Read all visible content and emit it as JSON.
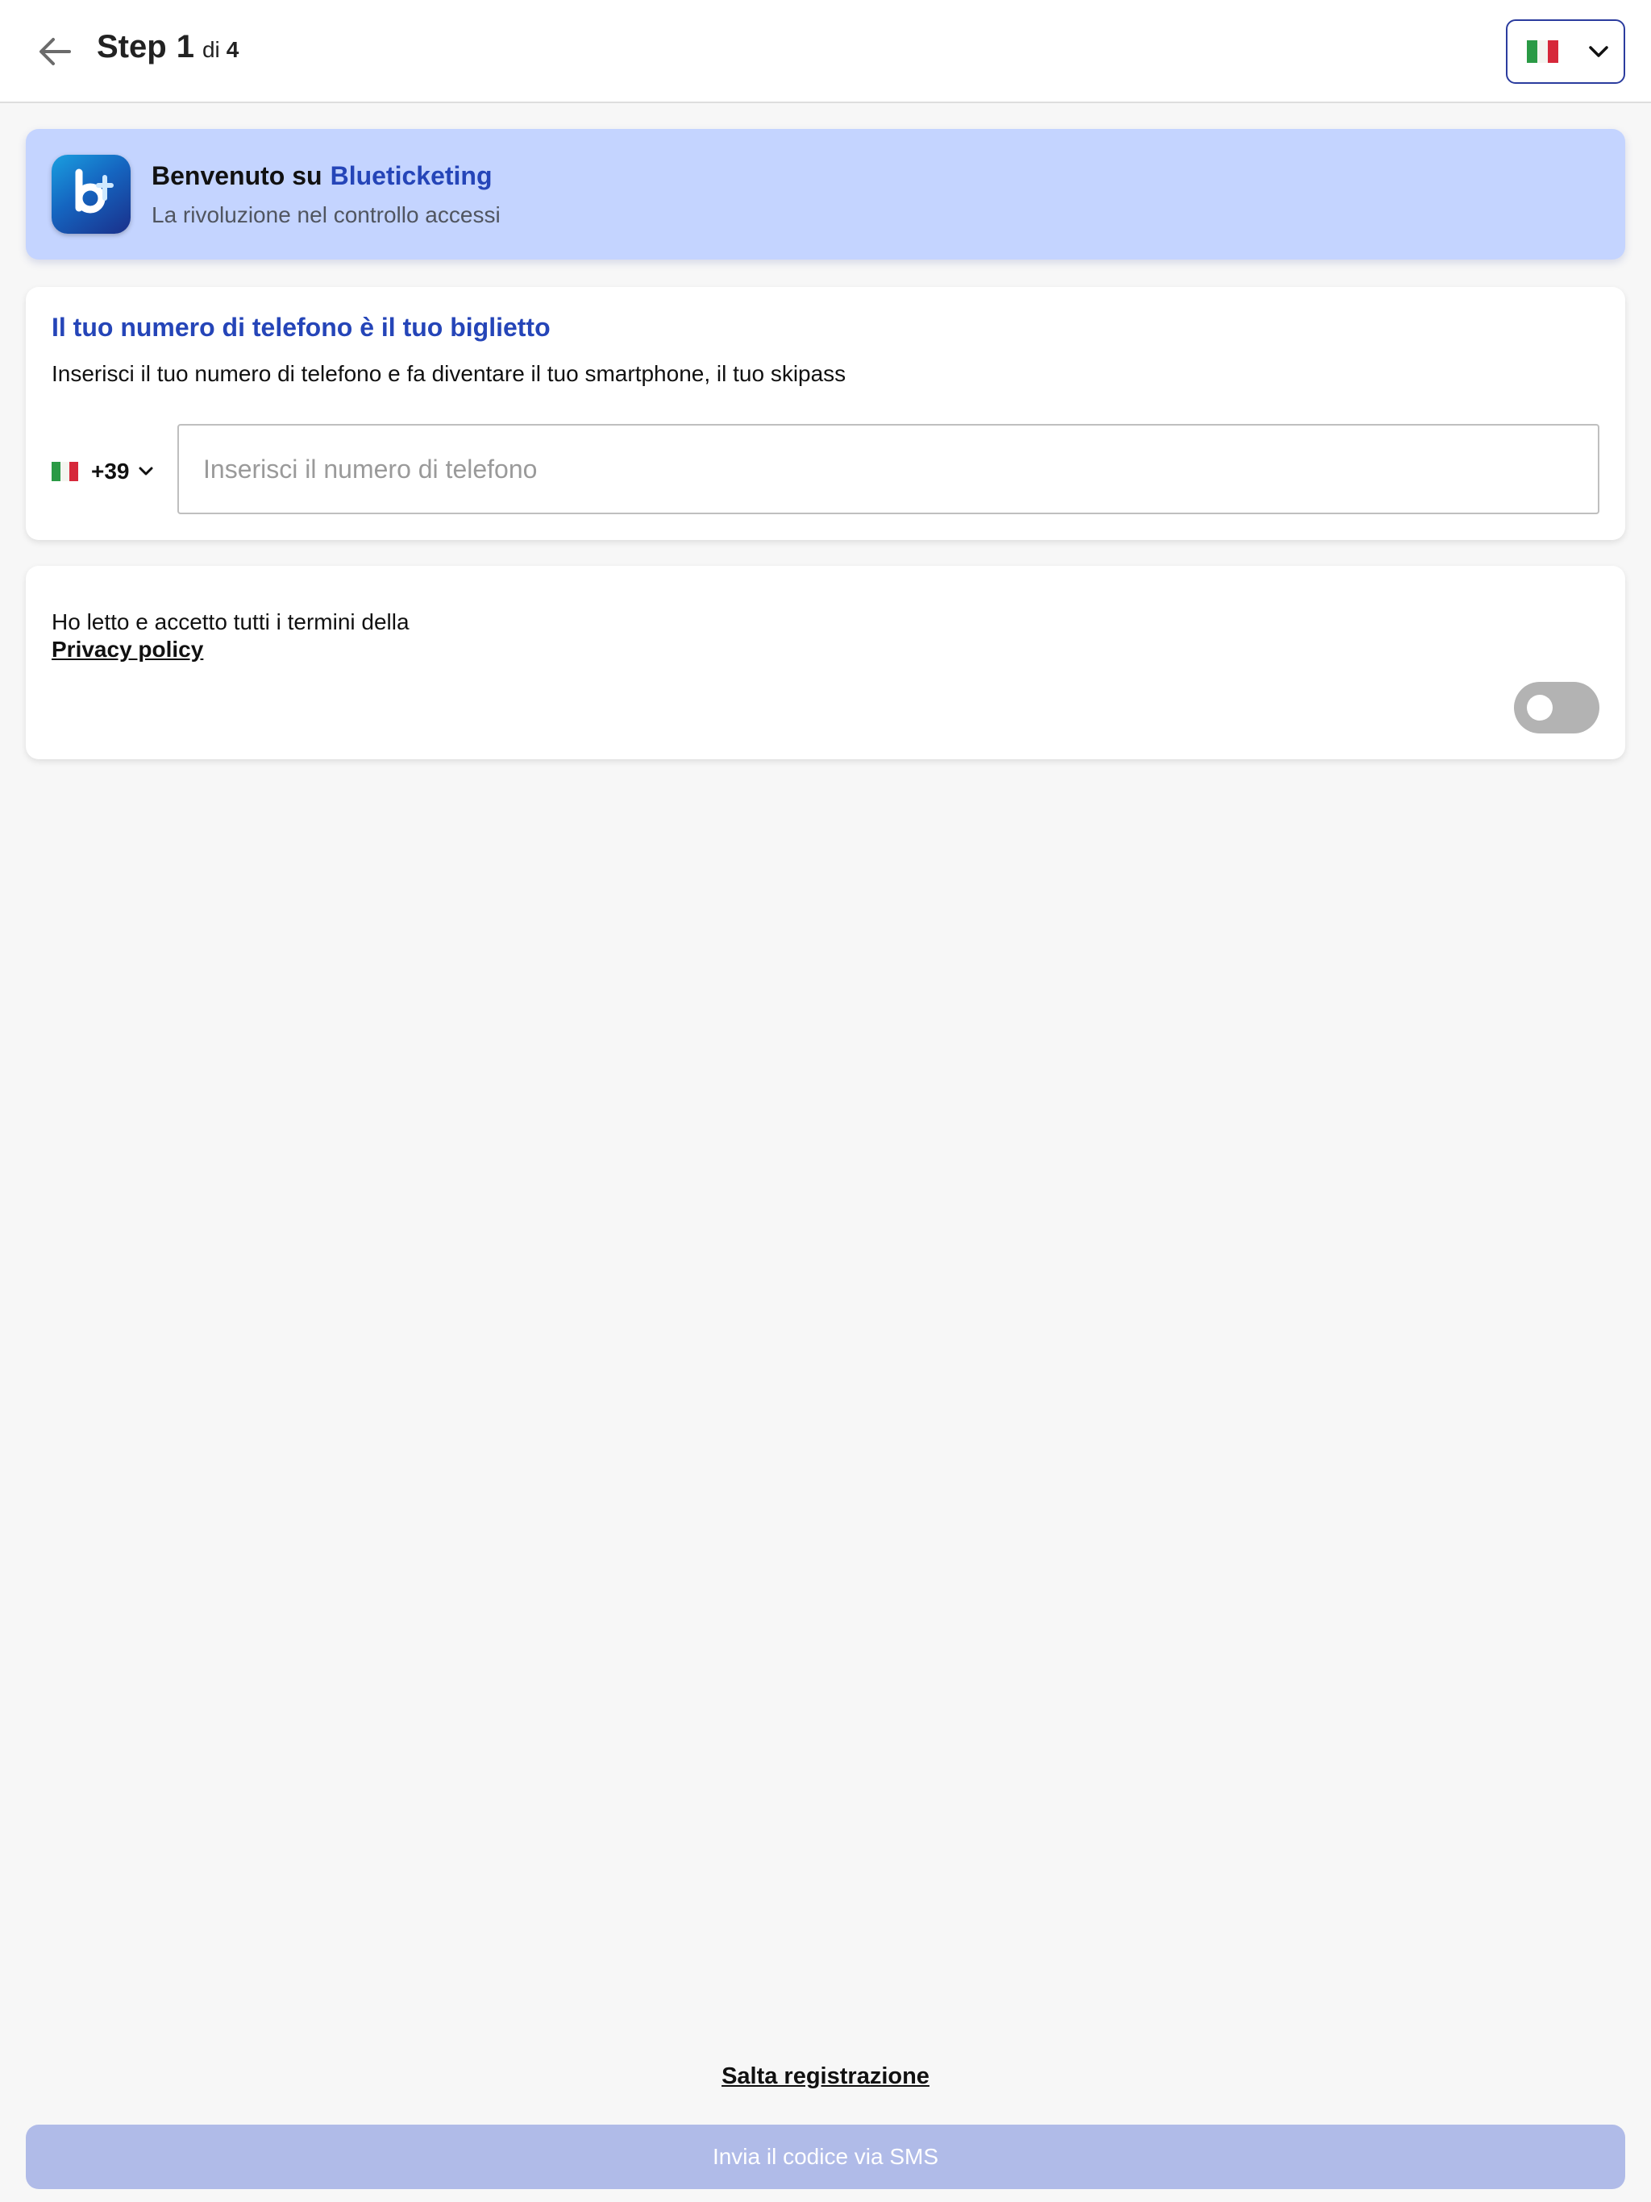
{
  "header": {
    "step_word": "Step",
    "step_current": "1",
    "step_of": "di",
    "step_total": "4"
  },
  "language": {
    "selected": "Italiano",
    "flag_colors": [
      "#2a9a45",
      "#f4f5f0",
      "#d6283a"
    ]
  },
  "welcome": {
    "title_prefix": "Benvenuto su",
    "brand": "Blueticketing",
    "subtitle": "La rivoluzione nel controllo accessi"
  },
  "phone": {
    "title": "Il tuo numero di telefono è il tuo biglietto",
    "description": "Inserisci il tuo numero di telefono e fa diventare il tuo smartphone, il tuo skipass",
    "country_code": "+39",
    "value": "",
    "placeholder": "Inserisci il numero di telefono"
  },
  "privacy": {
    "text": "Ho letto e accetto tutti i termini della",
    "link": "Privacy policy",
    "accepted": false
  },
  "footer": {
    "skip_label": "Salta registrazione",
    "submit_label": "Invia il codice via SMS"
  },
  "colors": {
    "accent": "#2545b8",
    "welcome_bg": "#c4d4ff",
    "button_disabled": "#b0bbe8",
    "toggle_off": "#b3b3b3"
  },
  "icons": {
    "back": "arrow-left-icon",
    "dropdown": "chevron-down-icon",
    "flag": "italy-flag-icon",
    "logo": "blueticketing-logo"
  }
}
